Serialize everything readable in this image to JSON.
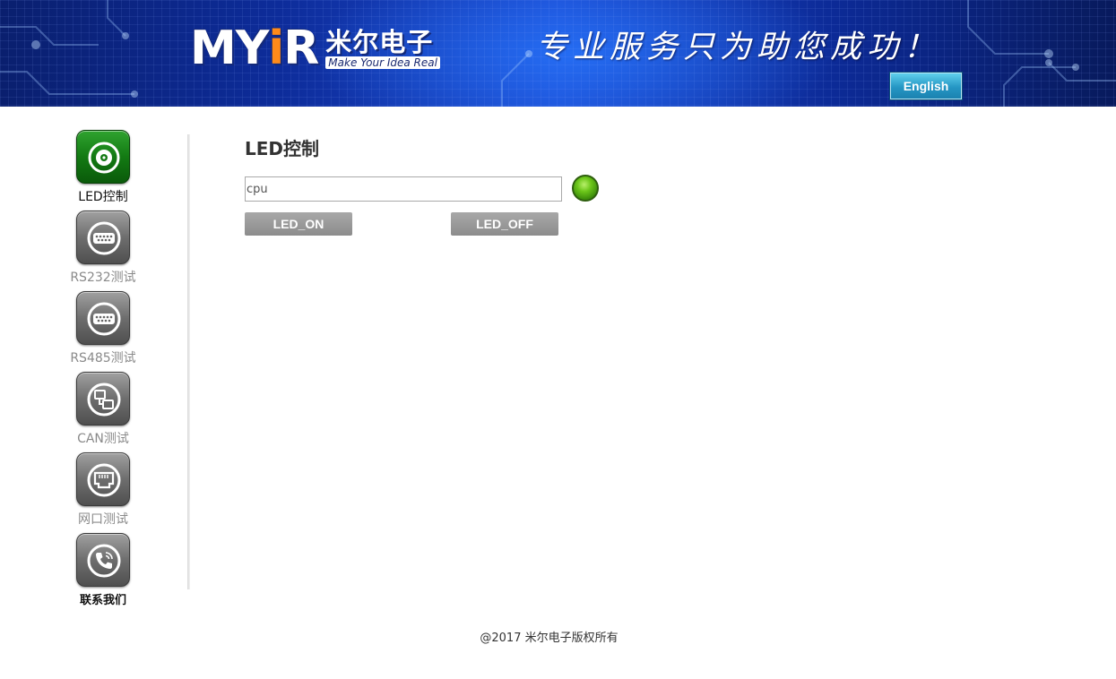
{
  "header": {
    "logo": {
      "brand": "MY",
      "brand_dot": "i",
      "brand_end": "R",
      "cn_name": "米尔电子",
      "tagline": "Make Your Idea Real"
    },
    "slogan": "专业服务只为助您成功！",
    "language_button": "English"
  },
  "sidebar": {
    "items": [
      {
        "label": "LED控制",
        "icon": "led-icon",
        "active": true
      },
      {
        "label": "RS232测试",
        "icon": "serial-port-icon",
        "active": false
      },
      {
        "label": "RS485测试",
        "icon": "serial-port-icon",
        "active": false
      },
      {
        "label": "CAN测试",
        "icon": "can-network-icon",
        "active": false
      },
      {
        "label": "网口测试",
        "icon": "ethernet-port-icon",
        "active": false
      },
      {
        "label": "联系我们",
        "icon": "phone-icon",
        "active": false
      }
    ]
  },
  "main": {
    "title": "LED控制",
    "led_input": {
      "value": "cpu",
      "placeholder": ""
    },
    "led_status": "on",
    "led_on_label": "LED_ON",
    "led_off_label": "LED_OFF"
  },
  "footer": {
    "copyright": "@2017 米尔电子版权所有"
  },
  "colors": {
    "banner_blue": "#1c4ad0",
    "active_green": "#137a13",
    "led_green": "#6cc61a",
    "button_gray": "#999999",
    "language_button": "#2596c4"
  }
}
